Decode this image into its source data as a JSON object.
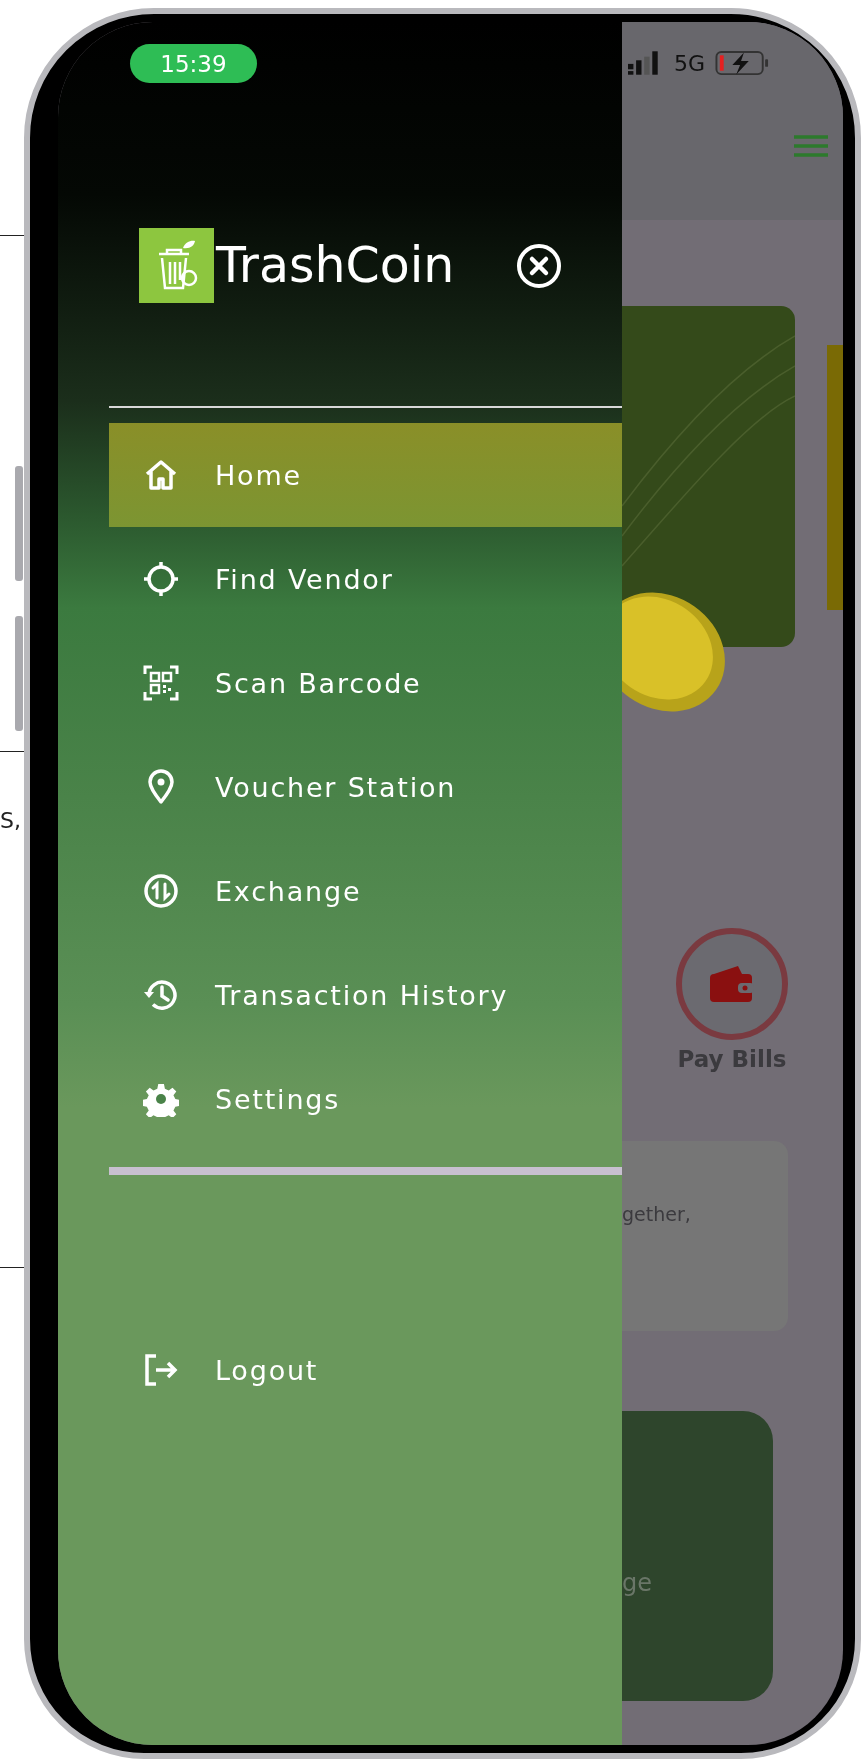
{
  "page_margin_text": "S,",
  "status_bar": {
    "time": "15:39",
    "network": "5G"
  },
  "drawer": {
    "app_name": "TrashCoin",
    "menu": [
      {
        "label": "Home",
        "selected": true
      },
      {
        "label": "Find Vendor",
        "selected": false
      },
      {
        "label": "Scan Barcode",
        "selected": false
      },
      {
        "label": "Voucher Station",
        "selected": false
      },
      {
        "label": "Exchange",
        "selected": false
      },
      {
        "label": "Transaction History",
        "selected": false
      },
      {
        "label": "Settings",
        "selected": false
      }
    ],
    "logout": "Logout"
  },
  "background_app": {
    "pay_bills": "Pay Bills",
    "card_text": "gether,",
    "button_text": "ge"
  }
}
